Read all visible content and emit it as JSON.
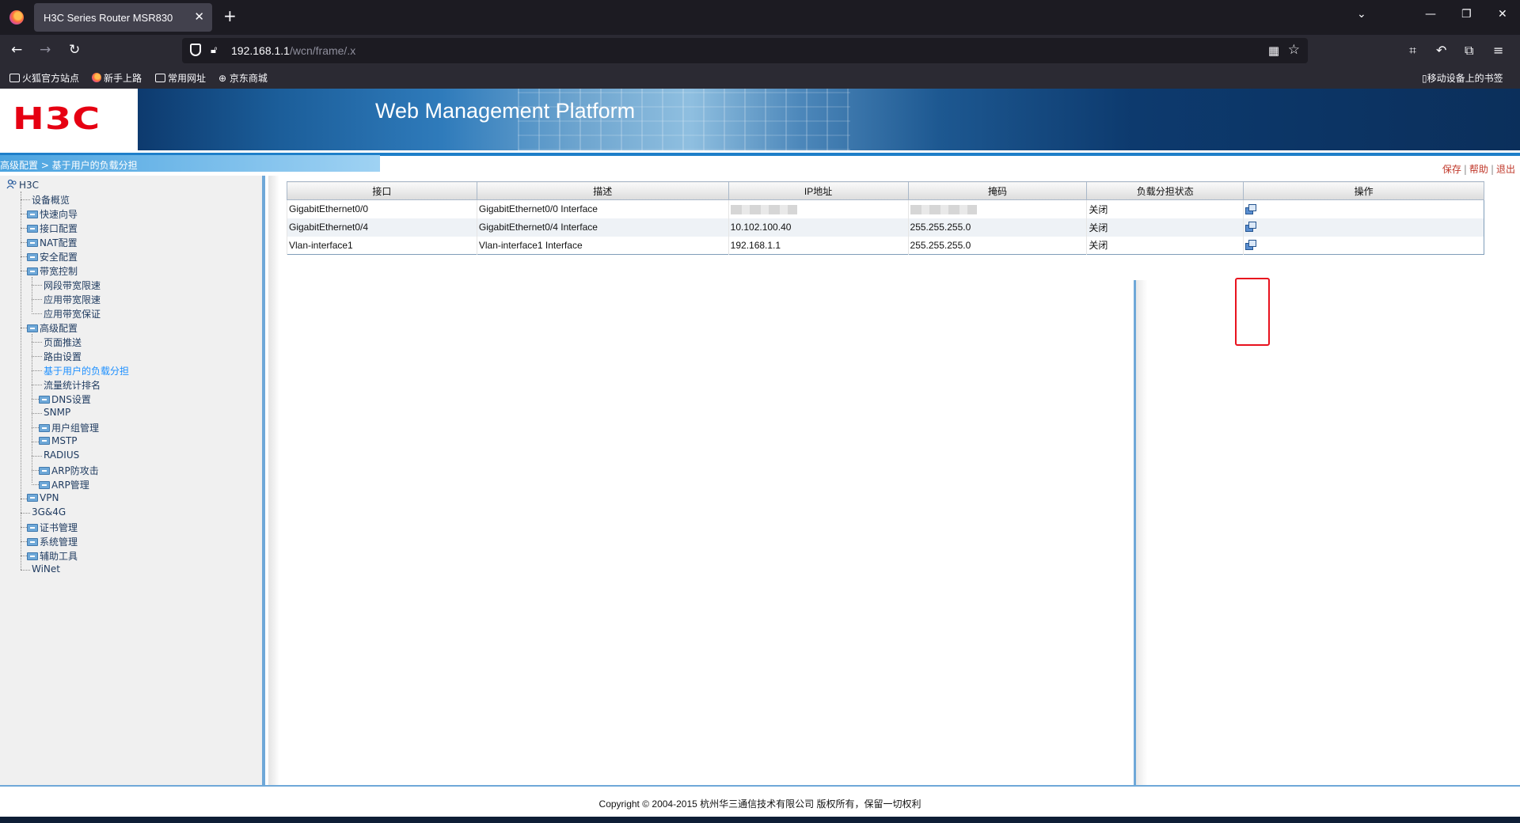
{
  "browser": {
    "tab_title": "H3C Series Router MSR830",
    "url_host": "192.168.1.1",
    "url_path": "/wcn/frame/.x",
    "bookmarks": [
      "火狐官方站点",
      "新手上路",
      "常用网址",
      "京东商城"
    ],
    "mobile_bookmarks": "移动设备上的书签"
  },
  "header": {
    "logo": "H3C",
    "title": "Web Management Platform"
  },
  "breadcrumb": {
    "path": "高级配置 > 基于用户的负载分担",
    "links": [
      "保存",
      "帮助",
      "退出"
    ]
  },
  "sidebar": {
    "root": "H3C",
    "items": [
      {
        "label": "设备概览",
        "folder": false
      },
      {
        "label": "快速向导",
        "folder": true
      },
      {
        "label": "接口配置",
        "folder": true
      },
      {
        "label": "NAT配置",
        "folder": true
      },
      {
        "label": "安全配置",
        "folder": true
      },
      {
        "label": "带宽控制",
        "folder": true
      },
      {
        "label": "网段带宽限速",
        "folder": false
      },
      {
        "label": "应用带宽限速",
        "folder": false
      },
      {
        "label": "应用带宽保证",
        "folder": false
      },
      {
        "label": "高级配置",
        "folder": true
      },
      {
        "label": "页面推送",
        "folder": false
      },
      {
        "label": "路由设置",
        "folder": false
      },
      {
        "label": "基于用户的负载分担",
        "folder": false
      },
      {
        "label": "流量统计排名",
        "folder": false
      },
      {
        "label": "DNS设置",
        "folder": true
      },
      {
        "label": "SNMP",
        "folder": false
      },
      {
        "label": "用户组管理",
        "folder": true
      },
      {
        "label": "MSTP",
        "folder": true
      },
      {
        "label": "RADIUS",
        "folder": false
      },
      {
        "label": "ARP防攻击",
        "folder": true
      },
      {
        "label": "ARP管理",
        "folder": true
      },
      {
        "label": "VPN",
        "folder": true
      },
      {
        "label": "3G&4G",
        "folder": false
      },
      {
        "label": "证书管理",
        "folder": true
      },
      {
        "label": "系统管理",
        "folder": true
      },
      {
        "label": "辅助工具",
        "folder": true
      },
      {
        "label": "WiNet",
        "folder": false
      }
    ]
  },
  "table": {
    "headers": [
      "接口",
      "描述",
      "IP地址",
      "掩码",
      "负载分担状态",
      "操作"
    ],
    "rows": [
      {
        "iface": "GigabitEthernet0/0",
        "desc": "GigabitEthernet0/0 Interface",
        "ip": "",
        "mask": "",
        "status": "关闭"
      },
      {
        "iface": "GigabitEthernet0/4",
        "desc": "GigabitEthernet0/4 Interface",
        "ip": "10.102.100.40",
        "mask": "255.255.255.0",
        "status": "关闭"
      },
      {
        "iface": "Vlan-interface1",
        "desc": "Vlan-interface1 Interface",
        "ip": "192.168.1.1",
        "mask": "255.255.255.0",
        "status": "关闭"
      }
    ]
  },
  "footer": {
    "copyright": "Copyright © 2004-2015 杭州华三通信技术有限公司 版权所有，保留一切权利"
  },
  "colors": {
    "brand_red": "#e60012",
    "header_blue": "#0c2f5c",
    "link_red": "#c0392b",
    "highlight_box": "#e8121e"
  }
}
